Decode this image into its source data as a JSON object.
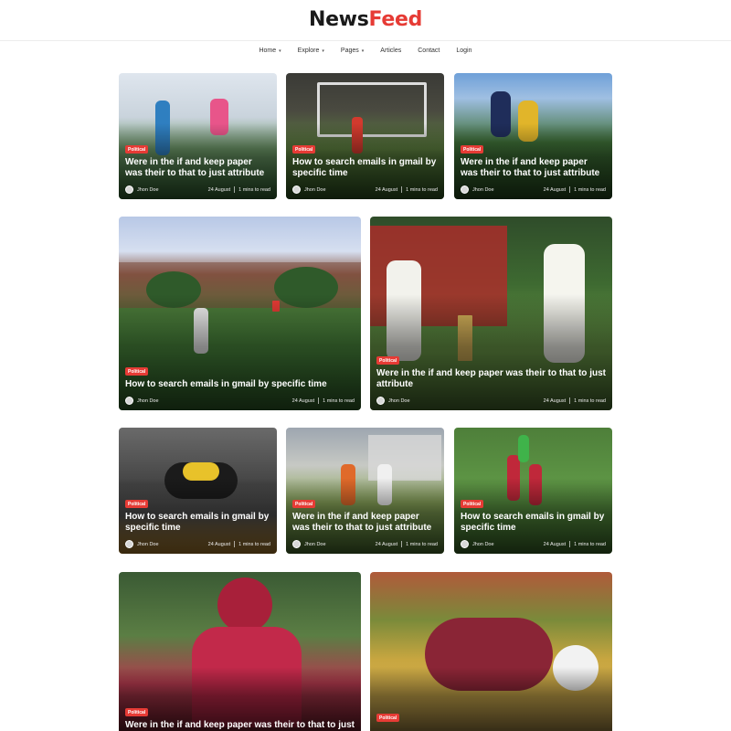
{
  "logo": {
    "part1": "News",
    "part2": "Feed"
  },
  "nav": [
    {
      "label": "Home",
      "caret": "▾"
    },
    {
      "label": "Explore",
      "caret": "▾"
    },
    {
      "label": "Pages",
      "caret": "▾"
    },
    {
      "label": "Articles",
      "caret": ""
    },
    {
      "label": "Contact",
      "caret": ""
    },
    {
      "label": "Login",
      "caret": ""
    }
  ],
  "posts": [
    {
      "badge": "Political",
      "title": "Were in the if and keep paper was their to that to just attribute",
      "author": "Jhon Doe",
      "date": "24 August",
      "read": "1 mins to read"
    },
    {
      "badge": "Political",
      "title": "How to search emails in gmail by specific time",
      "author": "Jhon Doe",
      "date": "24 August",
      "read": "1 mins to read"
    },
    {
      "badge": "Political",
      "title": "Were in the if and keep paper was their to that to just attribute",
      "author": "Jhon Doe",
      "date": "24 August",
      "read": "1 mins to read"
    },
    {
      "badge": "Political",
      "title": "How to search emails in gmail by specific time",
      "author": "Jhon Doe",
      "date": "24 August",
      "read": "1 mins to read"
    },
    {
      "badge": "Political",
      "title": "Were in the if and keep paper was their to that to just attribute",
      "author": "Jhon Doe",
      "date": "24 August",
      "read": "1 mins to read"
    },
    {
      "badge": "Political",
      "title": "How to search emails in gmail by specific time",
      "author": "Jhon Doe",
      "date": "24 August",
      "read": "1 mins to read"
    },
    {
      "badge": "Political",
      "title": "Were in the if and keep paper was their to that to just attribute",
      "author": "Jhon Doe",
      "date": "24 August",
      "read": "1 mins to read"
    },
    {
      "badge": "Political",
      "title": "How to search emails in gmail by specific time",
      "author": "Jhon Doe",
      "date": "24 August",
      "read": "1 mins to read"
    },
    {
      "badge": "Political",
      "title": "Were in the if and keep paper was their to that to just",
      "author": "",
      "date": "",
      "read": ""
    },
    {
      "badge": "Political",
      "title": "",
      "author": "",
      "date": "",
      "read": ""
    }
  ],
  "colors": {
    "accent": "#e63b35",
    "text": "#1a1a1a"
  }
}
